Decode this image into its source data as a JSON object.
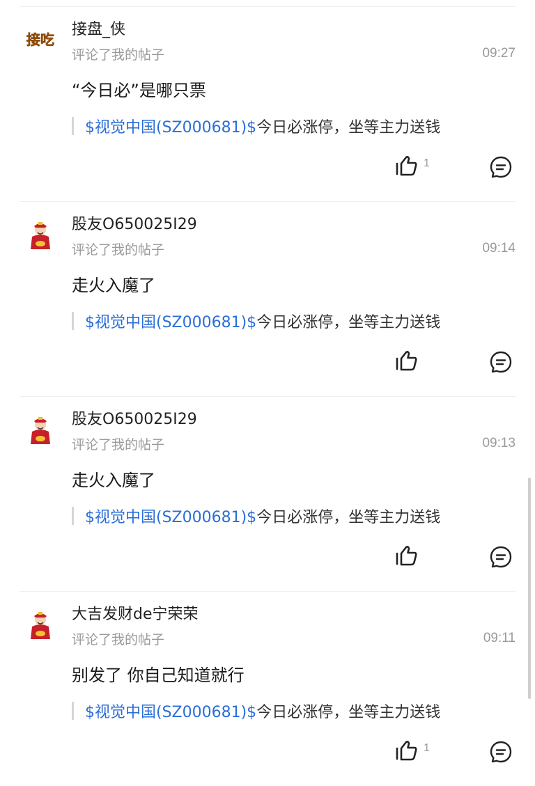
{
  "notifications": [
    {
      "username": "接盘_侠",
      "avatar": "badge-logo",
      "avatar_text": "接吃",
      "action_text": "评论了我的帖子",
      "time": "09:27",
      "comment": "“今日必”是哪只票",
      "quote": {
        "stock": "$视觉中国(SZ000681)$",
        "text": "今日必涨停，坐等主力送钱"
      },
      "like_count": "1"
    },
    {
      "username": "股友O650025I29",
      "avatar": "fortune-god-avatar",
      "action_text": "评论了我的帖子",
      "time": "09:14",
      "comment": "走火入魔了",
      "quote": {
        "stock": "$视觉中国(SZ000681)$",
        "text": "今日必涨停，坐等主力送钱"
      },
      "like_count": ""
    },
    {
      "username": "股友O650025I29",
      "avatar": "fortune-god-avatar",
      "action_text": "评论了我的帖子",
      "time": "09:13",
      "comment": "走火入魔了",
      "quote": {
        "stock": "$视觉中国(SZ000681)$",
        "text": "今日必涨停，坐等主力送钱"
      },
      "like_count": ""
    },
    {
      "username": "大吉发财de宁荣荣",
      "avatar": "fortune-god-avatar",
      "action_text": "评论了我的帖子",
      "time": "09:11",
      "comment": "别发了 你自己知道就行",
      "quote": {
        "stock": "$视觉中国(SZ000681)$",
        "text": "今日必涨停，坐等主力送钱"
      },
      "like_count": "1"
    }
  ],
  "icons": {
    "like": "thumbs-up-icon",
    "reply": "comment-bubble-icon"
  },
  "colors": {
    "link": "#2a6ed8",
    "muted": "#9a9a9a",
    "quote_bar": "#d6d6d6"
  }
}
